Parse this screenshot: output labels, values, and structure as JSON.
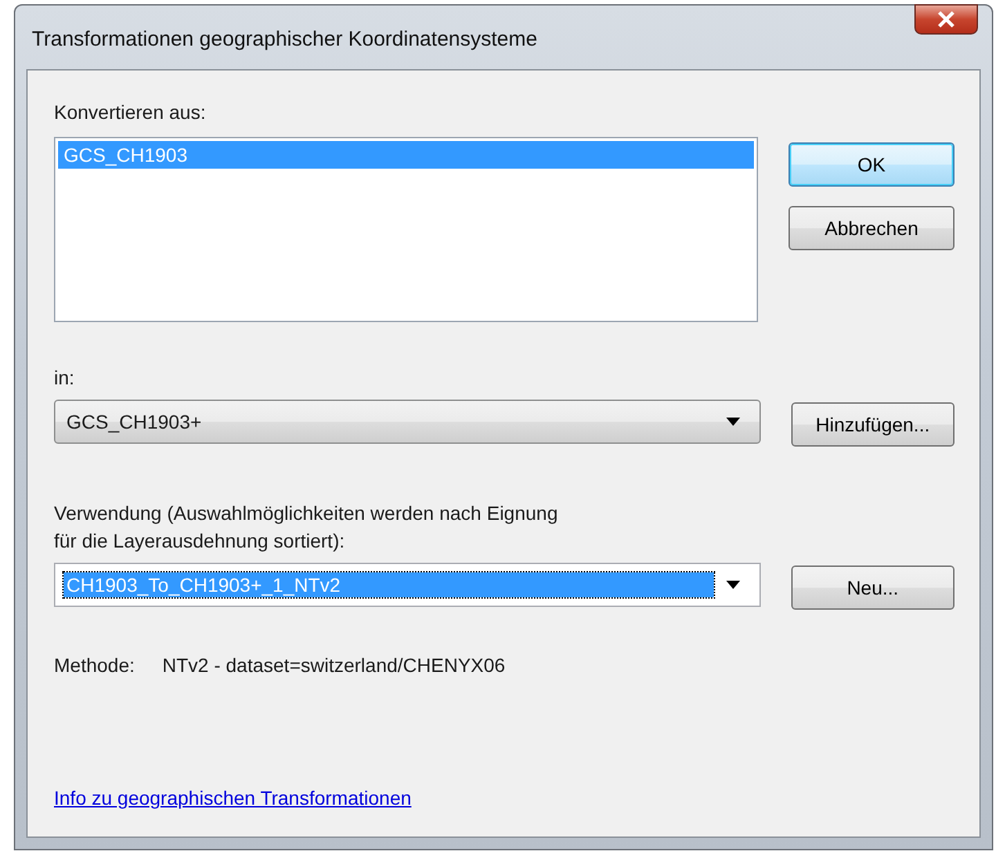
{
  "window": {
    "title": "Transformationen geographischer Koordinatensysteme"
  },
  "source": {
    "label": "Konvertieren aus:",
    "items": [
      {
        "text": "GCS_CH1903",
        "selected": true
      }
    ]
  },
  "target": {
    "label": "in:",
    "value": "GCS_CH1903+"
  },
  "usage": {
    "label": "Verwendung (Auswahlmöglichkeiten werden nach Eignung\nfür die Layerausdehnung sortiert):",
    "value": "CH1903_To_CH1903+_1_NTv2",
    "text_selected": true
  },
  "buttons": [
    {
      "label": "OK",
      "default": true
    },
    {
      "label": "Abbrechen",
      "default": false
    }
  ],
  "add_button": {
    "label": "Hinzufügen..."
  },
  "new_button": {
    "label": "Neu..."
  },
  "method": {
    "label": "Methode:",
    "value": "NTv2 - dataset=switzerland/CHENYX06"
  },
  "link": "Info zu geographischen Transformationen"
}
